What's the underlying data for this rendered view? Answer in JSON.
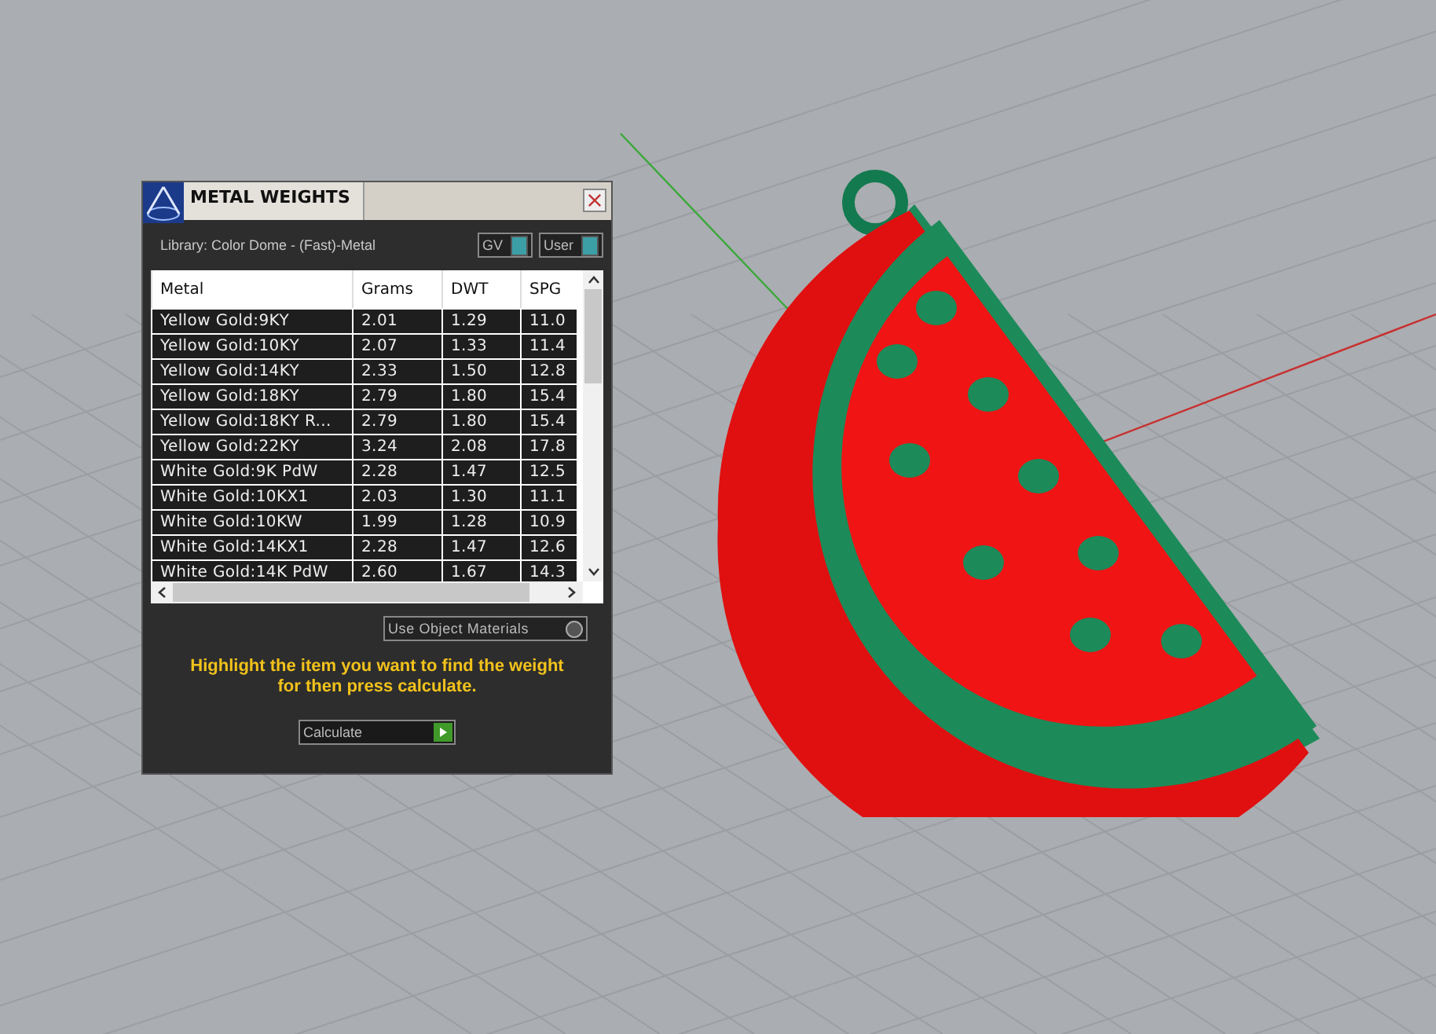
{
  "window": {
    "title": "METAL WEIGHTS"
  },
  "library": {
    "label": "Library: Color Dome - (Fast)-Metal"
  },
  "toggles": [
    {
      "label": "GV",
      "on": true
    },
    {
      "label": "User",
      "on": true
    }
  ],
  "table": {
    "columns": [
      "Metal",
      "Grams",
      "DWT",
      "SPG"
    ],
    "rows": [
      {
        "metal": "Yellow Gold:9KY",
        "grams": "2.01",
        "dwt": "1.29",
        "spg": "11.0"
      },
      {
        "metal": "Yellow Gold:10KY",
        "grams": "2.07",
        "dwt": "1.33",
        "spg": "11.4"
      },
      {
        "metal": "Yellow Gold:14KY",
        "grams": "2.33",
        "dwt": "1.50",
        "spg": "12.8"
      },
      {
        "metal": "Yellow Gold:18KY",
        "grams": "2.79",
        "dwt": "1.80",
        "spg": "15.4"
      },
      {
        "metal": "Yellow Gold:18KY R...",
        "grams": "2.79",
        "dwt": "1.80",
        "spg": "15.4"
      },
      {
        "metal": "Yellow Gold:22KY",
        "grams": "3.24",
        "dwt": "2.08",
        "spg": "17.8"
      },
      {
        "metal": "White Gold:9K PdW",
        "grams": "2.28",
        "dwt": "1.47",
        "spg": "12.5"
      },
      {
        "metal": "White Gold:10KX1",
        "grams": "2.03",
        "dwt": "1.30",
        "spg": "11.1"
      },
      {
        "metal": "White Gold:10KW",
        "grams": "1.99",
        "dwt": "1.28",
        "spg": "10.9"
      },
      {
        "metal": "White Gold:14KX1",
        "grams": "2.28",
        "dwt": "1.47",
        "spg": "12.6"
      },
      {
        "metal": "White Gold:14K PdW",
        "grams": "2.60",
        "dwt": "1.67",
        "spg": "14.3"
      }
    ]
  },
  "use_object_materials": {
    "label": "Use Object Materials",
    "checked": false
  },
  "instruction": "Highlight the item you want to find the weight for then press calculate.",
  "calculate_button": {
    "label": "Calculate"
  }
}
